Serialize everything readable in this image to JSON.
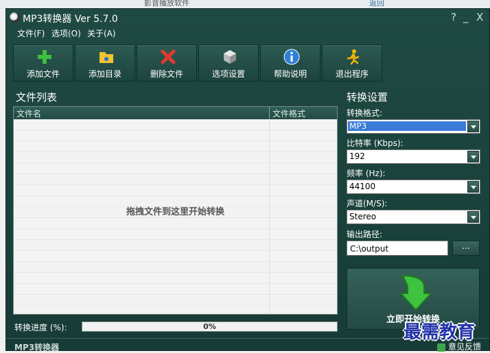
{
  "background": {
    "text_left": "影音播放软件",
    "link_right": "返回"
  },
  "window": {
    "title": "MP3转换器 Ver 5.7.0",
    "controls": [
      "?",
      "_",
      "X"
    ]
  },
  "menu": [
    "文件(F)",
    "选项(O)",
    "关于(A)"
  ],
  "toolbar": [
    {
      "label": "添加文件",
      "icon": "add-file-icon"
    },
    {
      "label": "添加目录",
      "icon": "add-folder-icon"
    },
    {
      "label": "删除文件",
      "icon": "delete-icon"
    },
    {
      "label": "选项设置",
      "icon": "settings-cube-icon"
    },
    {
      "label": "帮助说明",
      "icon": "info-icon"
    },
    {
      "label": "退出程序",
      "icon": "exit-runner-icon"
    }
  ],
  "file_list": {
    "title": "文件列表",
    "columns": [
      "文件名",
      "文件格式"
    ],
    "drop_hint": "拖拽文件到这里开始转换"
  },
  "progress": {
    "label": "转换进度 (%):",
    "value": 0,
    "text": "0%"
  },
  "settings": {
    "title": "转换设置",
    "format_label": "转换格式:",
    "format_value": "MP3",
    "bitrate_label": "比特率 (Kbps):",
    "bitrate_value": "192",
    "frequency_label": "频率 (Hz):",
    "frequency_value": "44100",
    "channel_label": "声道(M/S):",
    "channel_value": "Stereo",
    "output_label": "输出路径:",
    "output_value": "C:\\output",
    "browse_label": "...",
    "convert_label": "立即开始转换"
  },
  "status": {
    "text": "MP3转换器",
    "feedback": "意见反馈"
  },
  "watermark": "最需教育",
  "colors": {
    "window_bg": "#1f4a43",
    "accent_green": "#3fbf3f",
    "selection_blue": "#3a7ad8"
  }
}
